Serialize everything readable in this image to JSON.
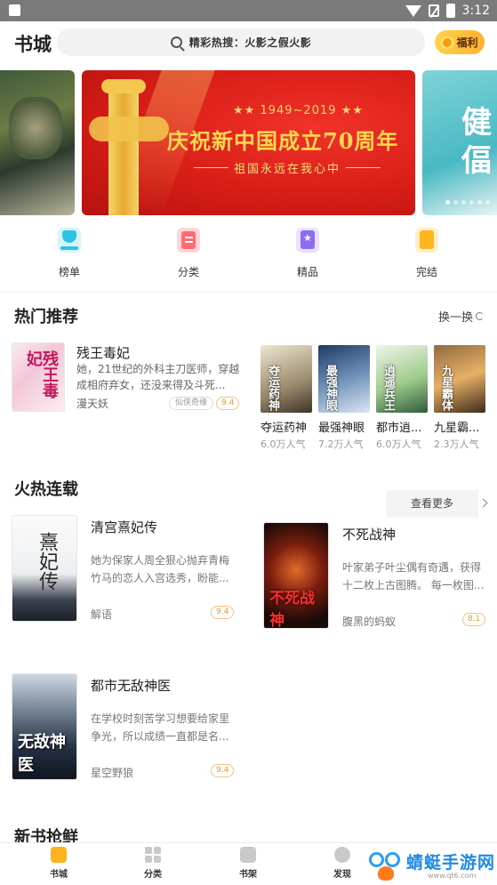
{
  "status_bar": {
    "time": "3:12"
  },
  "header": {
    "title": "书城",
    "search_text": "精彩热搜：火影之假火影",
    "welfare_label": "福利"
  },
  "banner": {
    "years": "★★ 1949~2019 ★★",
    "title": "庆祝新中国成立70周年",
    "subtitle": "祖国永远在我心中",
    "right_text": "健 偪",
    "page_count": 6,
    "active_page": 1
  },
  "categories": [
    {
      "label": "榜单",
      "icon": "trophy-icon"
    },
    {
      "label": "分类",
      "icon": "category-icon"
    },
    {
      "label": "精品",
      "icon": "star-book-icon"
    },
    {
      "label": "完结",
      "icon": "book-icon"
    }
  ],
  "hot_recommend": {
    "title": "热门推荐",
    "refresh_label": "换一换",
    "featured": {
      "title": "残王毒妃",
      "cover_text": "残王毒妃",
      "description": "她，21世纪的外科主刀医师，穿越成相府弃女，还没来得及斗死...",
      "author": "漫天妖",
      "tag": "仙侠奇缘",
      "score": "9.4"
    },
    "books": [
      {
        "title": "夺运药神",
        "popularity": "6.0万人气",
        "cover_text": "夺运药神"
      },
      {
        "title": "最强神眼",
        "popularity": "7.2万人气",
        "cover_text": "最强神眼"
      },
      {
        "title": "都市逍...",
        "popularity": "6.0万人气",
        "cover_text": "逍遥兵王"
      },
      {
        "title": "九星霸...",
        "popularity": "2.3万人气",
        "cover_text": "九星霸体"
      }
    ]
  },
  "serial": {
    "title": "火热连载",
    "more_label": "查看更多",
    "books": [
      {
        "title": "清宫熹妃传",
        "cover_text": "熹妃传",
        "description": "她为保家人周全狠心抛弃青梅竹马的恋人入宫选秀，盼能...",
        "author": "解语",
        "score": "9.4"
      },
      {
        "title": "不死战神",
        "cover_text": "不死战神",
        "description": "叶家弟子叶尘偶有奇遇，获得十二枚上古图腾。 每一枚图...",
        "author": "腹黑的蚂蚁",
        "score": "8.1"
      },
      {
        "title": "都市无敌神医",
        "cover_text": "无敌神医",
        "description": "在学校时刻苦学习想要给家里争光，所以成绩一直都是名...",
        "author": "星空野狼",
        "score": "9.4"
      }
    ]
  },
  "new_books": {
    "title": "新书抢鲜"
  },
  "bottom_nav": [
    {
      "label": "书城",
      "active": true
    },
    {
      "label": "分类",
      "active": false
    },
    {
      "label": "书架",
      "active": false
    },
    {
      "label": "发现",
      "active": false
    }
  ],
  "watermark": {
    "text": "蜻蜓手游网",
    "sub": "www.qt6.com"
  },
  "colors": {
    "accent": "#ffb21f",
    "banner_red": "#d81d17",
    "banner_gold": "#ffd84f"
  }
}
